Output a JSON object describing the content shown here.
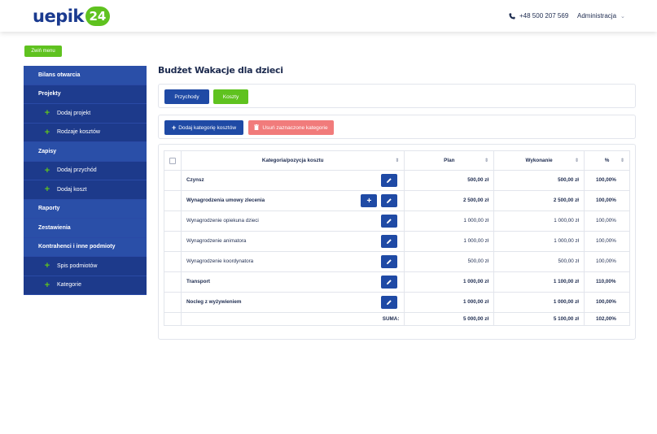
{
  "header": {
    "logo_text": "uepik",
    "logo_badge": "24",
    "phone": "+48 500 207 569",
    "user_menu": "Administracja"
  },
  "collapse_menu_label": "Zwiń menu",
  "sidebar": {
    "items": [
      {
        "label": "Bilans otwarcia",
        "type": "section"
      },
      {
        "label": "Projekty",
        "type": "section-active"
      },
      {
        "label": "Dodaj projekt",
        "type": "sub"
      },
      {
        "label": "Rodzaje kosztów",
        "type": "sub"
      },
      {
        "label": "Zapisy",
        "type": "section"
      },
      {
        "label": "Dodaj przychód",
        "type": "sub"
      },
      {
        "label": "Dodaj koszt",
        "type": "sub"
      },
      {
        "label": "Raporty",
        "type": "section"
      },
      {
        "label": "Zestawienia",
        "type": "section"
      },
      {
        "label": "Kontrahenci i inne podmioty",
        "type": "section"
      },
      {
        "label": "Spis podmiotów",
        "type": "sub"
      },
      {
        "label": "Kategorie",
        "type": "sub"
      }
    ]
  },
  "main": {
    "title": "Budżet Wakacje dla dzieci",
    "tabs": {
      "income": "Przychody",
      "costs": "Koszty"
    },
    "add_category": "Dodaj kategorię kosztów",
    "delete_selected": "Usuń zaznaczone kategorie"
  },
  "table": {
    "headers": {
      "name": "Kategoria/pozycja kosztu",
      "plan": "Plan",
      "done": "Wykonanie",
      "pct": "%"
    },
    "rows": [
      {
        "name": "Czynsz",
        "plan": "500,00 zł",
        "done": "500,00 zł",
        "pct": "100,00%",
        "bold": true,
        "add": false
      },
      {
        "name": "Wynagrodzenia umowy zlecenia",
        "plan": "2 500,00 zł",
        "done": "2 500,00 zł",
        "pct": "100,00%",
        "bold": true,
        "add": true
      },
      {
        "name": "Wynagrodzenie opiekuna dzieci",
        "plan": "1 000,00 zł",
        "done": "1 000,00 zł",
        "pct": "100,00%",
        "bold": false,
        "add": false
      },
      {
        "name": "Wynagrodzenie animatora",
        "plan": "1 000,00 zł",
        "done": "1 000,00 zł",
        "pct": "100,00%",
        "bold": false,
        "add": false
      },
      {
        "name": "Wynagrodzenie koordynatora",
        "plan": "500,00 zł",
        "done": "500,00 zł",
        "pct": "100,00%",
        "bold": false,
        "add": false
      },
      {
        "name": "Transport",
        "plan": "1 000,00 zł",
        "done": "1 100,00 zł",
        "pct": "110,00%",
        "bold": true,
        "add": false
      },
      {
        "name": "Nocleg z wyżywieniem",
        "plan": "1 000,00 zł",
        "done": "1 000,00 zł",
        "pct": "100,00%",
        "bold": true,
        "add": false
      }
    ],
    "sum": {
      "label": "SUMA:",
      "plan": "5 000,00 zł",
      "done": "5 100,00 zł",
      "pct": "102,00%"
    }
  }
}
